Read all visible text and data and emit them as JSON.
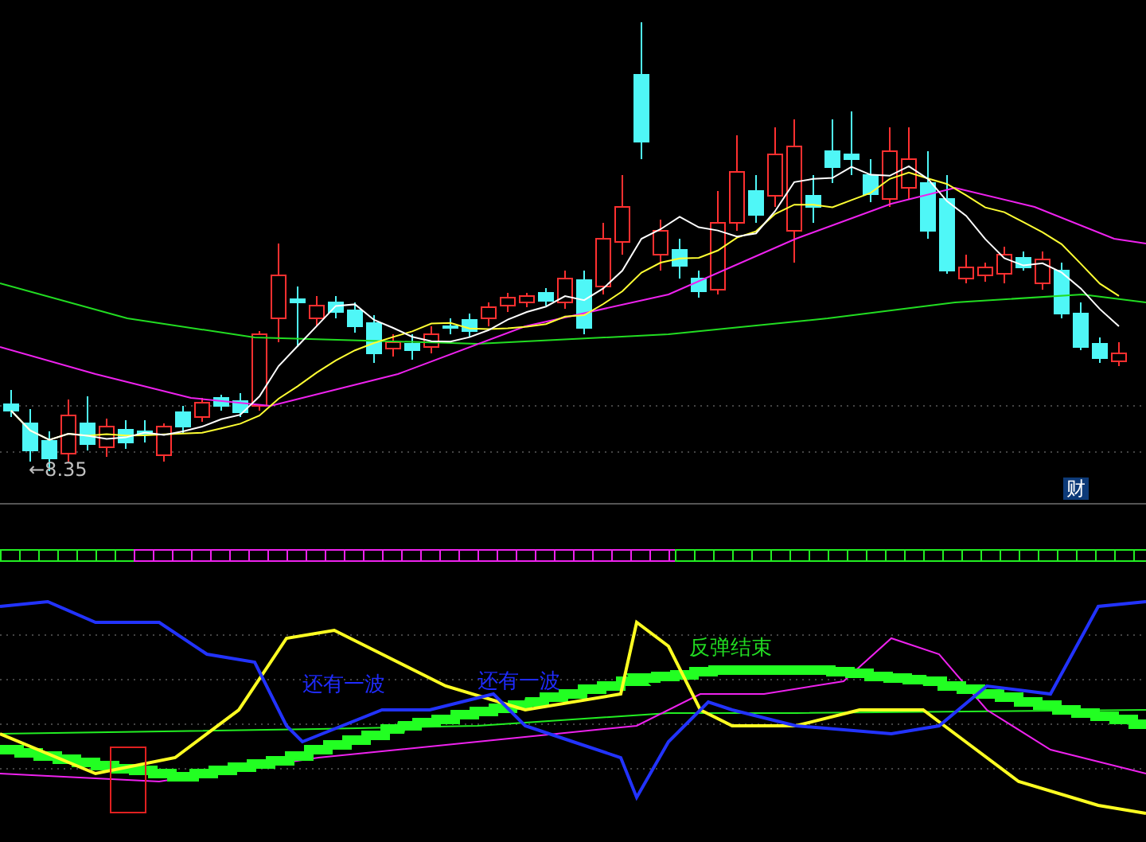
{
  "main_chart": {
    "low_price_label": "←8.35",
    "badge": "财"
  },
  "indicator_chart": {
    "signals": [
      {
        "text": "还有一波",
        "color": "#1f2bff"
      },
      {
        "text": "还有一波",
        "color": "#1f2bff"
      },
      {
        "text": "反弹结束",
        "color": "#22dd22"
      }
    ]
  }
}
